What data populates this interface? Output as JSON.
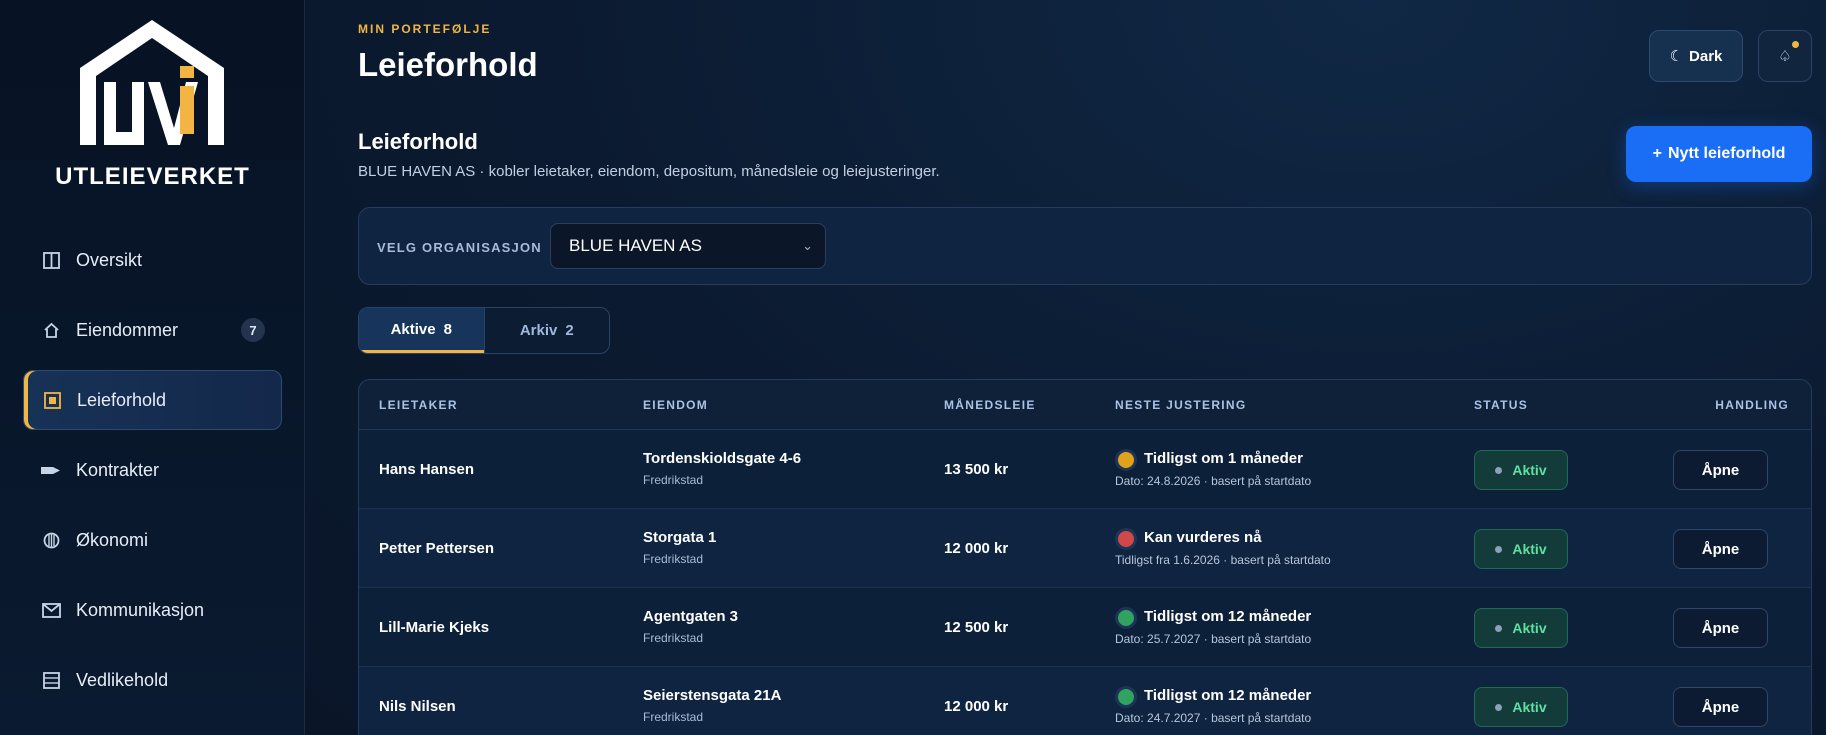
{
  "sidebar": {
    "brand": "UTLEIEVERKET",
    "items": [
      {
        "label": "Oversikt",
        "icon": "columns-icon",
        "badge": null,
        "active": false
      },
      {
        "label": "Eiendommer",
        "icon": "home-icon",
        "badge": "7",
        "active": false
      },
      {
        "label": "Leieforhold",
        "icon": "square-icon",
        "badge": null,
        "active": true
      },
      {
        "label": "Kontrakter",
        "icon": "pen-icon",
        "badge": null,
        "active": false
      },
      {
        "label": "Økonomi",
        "icon": "coin-icon",
        "badge": null,
        "active": false
      },
      {
        "label": "Kommunikasjon",
        "icon": "mail-icon",
        "badge": null,
        "active": false
      },
      {
        "label": "Vedlikehold",
        "icon": "list-icon",
        "badge": null,
        "active": false
      }
    ]
  },
  "header": {
    "eyebrow": "MIN PORTEFØLJE",
    "title": "Leieforhold",
    "theme_label": "Dark"
  },
  "section": {
    "title": "Leieforhold",
    "subtitle": "BLUE HAVEN AS · kobler leietaker, eiendom, depositum, månedsleie og leiejusteringer.",
    "new_button": "Nytt leieforhold"
  },
  "org": {
    "label": "VELG ORGANISASJON",
    "selected": "BLUE HAVEN AS"
  },
  "tabs": [
    {
      "label": "Aktive",
      "count": "8",
      "active": true
    },
    {
      "label": "Arkiv",
      "count": "2",
      "active": false
    }
  ],
  "table": {
    "headers": {
      "tenant": "LEIETAKER",
      "property": "EIENDOM",
      "rent": "MÅNEDSLEIE",
      "adjustment": "NESTE JUSTERING",
      "status": "STATUS",
      "action": "HANDLING"
    },
    "rows": [
      {
        "tenant": "Hans Hansen",
        "property": "Tordenskioldsgate 4-6",
        "city": "Fredrikstad",
        "rent": "13 500 kr",
        "adj_title": "Tidligst om 1 måneder",
        "adj_sub": "Dato: 24.8.2026 · basert på startdato",
        "adj_color": "#e0a21a",
        "status": "Aktiv",
        "action": "Åpne"
      },
      {
        "tenant": "Petter Pettersen",
        "property": "Storgata 1",
        "city": "Fredrikstad",
        "rent": "12 000 kr",
        "adj_title": "Kan vurderes nå",
        "adj_sub": "Tidligst fra 1.6.2026 · basert på startdato",
        "adj_color": "#d04848",
        "status": "Aktiv",
        "action": "Åpne"
      },
      {
        "tenant": "Lill-Marie Kjeks",
        "property": "Agentgaten 3",
        "city": "Fredrikstad",
        "rent": "12 500 kr",
        "adj_title": "Tidligst om 12 måneder",
        "adj_sub": "Dato: 25.7.2027 · basert på startdato",
        "adj_color": "#2fa35f",
        "status": "Aktiv",
        "action": "Åpne"
      },
      {
        "tenant": "Nils Nilsen",
        "property": "Seierstensgata 21A",
        "city": "Fredrikstad",
        "rent": "12 000 kr",
        "adj_title": "Tidligst om 12 måneder",
        "adj_sub": "Dato: 24.7.2027 · basert på startdato",
        "adj_color": "#2fa35f",
        "status": "Aktiv",
        "action": "Åpne"
      }
    ]
  }
}
